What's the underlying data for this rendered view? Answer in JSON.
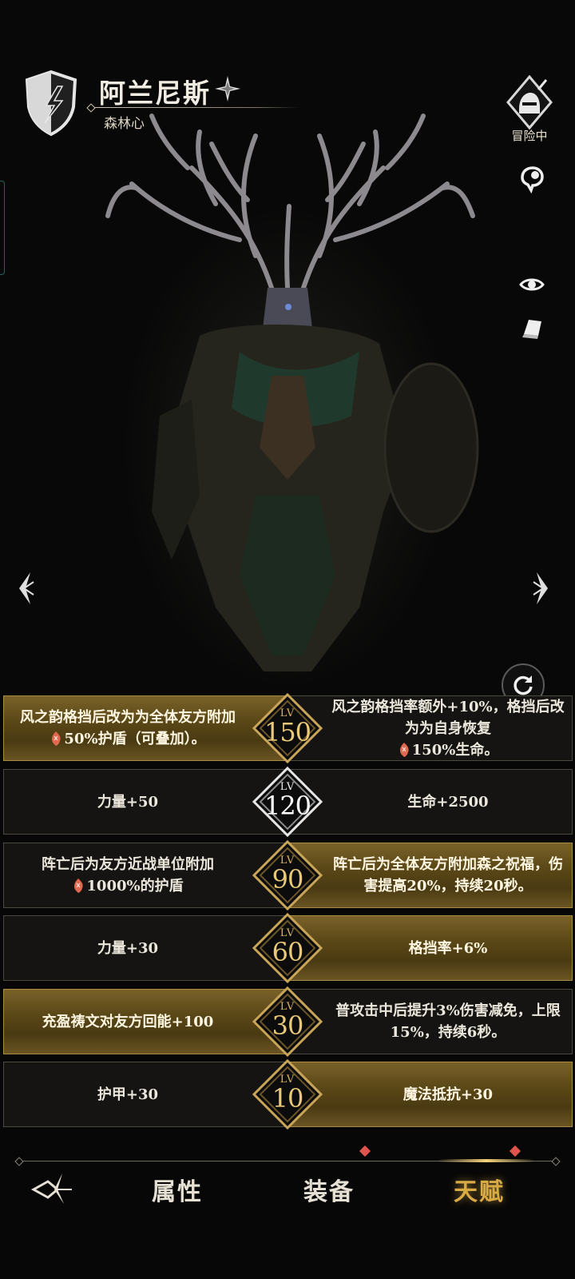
{
  "header": {
    "hero_name": "阿兰尼斯",
    "hero_subtitle": "森林心",
    "status": "冒险中"
  },
  "icons": {
    "class_badge": "lightning-shield-icon",
    "rarity": "star-icon",
    "status": "knight-helmet-sword-icon",
    "side_buttons": [
      "chat-bubble-icon",
      "eye-icon",
      "book-icon"
    ],
    "refresh": "refresh-icon",
    "prev": "arrow-left-icon",
    "next": "arrow-right-icon",
    "rune": "rune-icon"
  },
  "talents": [
    {
      "level_label": "LV",
      "level": "150",
      "left": {
        "text": "风之韵格挡后改为为全体友方附加",
        "rune": true,
        "text2": "50%护盾（可叠加）。",
        "selected": true
      },
      "right": {
        "text": "风之韵格挡率额外+10%，格挡后改为为自身恢复",
        "rune": true,
        "text2": "150%生命。",
        "selected": false
      }
    },
    {
      "level_label": "LV",
      "level": "120",
      "left": {
        "text": "力量+50",
        "selected": false
      },
      "right": {
        "text": "生命+2500",
        "selected": false
      }
    },
    {
      "level_label": "LV",
      "level": "90",
      "left": {
        "text": "阵亡后为友方近战单位附加",
        "rune": true,
        "text2": "1000%的护盾",
        "selected": false
      },
      "right": {
        "text": "阵亡后为全体友方附加森之祝福，伤害提高20%，持续20秒。",
        "selected": true
      }
    },
    {
      "level_label": "LV",
      "level": "60",
      "left": {
        "text": "力量+30",
        "selected": false
      },
      "right": {
        "text": "格挡率+6%",
        "selected": true
      }
    },
    {
      "level_label": "LV",
      "level": "30",
      "left": {
        "text": "充盈祷文对友方回能+100",
        "selected": true
      },
      "right": {
        "text": "普攻击中后提升3%伤害减免，上限15%，持续6秒。",
        "selected": false
      }
    },
    {
      "level_label": "LV",
      "level": "10",
      "left": {
        "text": "护甲+30",
        "selected": false
      },
      "right": {
        "text": "魔法抵抗+30",
        "selected": true
      }
    }
  ],
  "tabs": [
    {
      "label": "属性",
      "active": false,
      "notification": false
    },
    {
      "label": "装备",
      "active": false,
      "notification": true
    },
    {
      "label": "天赋",
      "active": true,
      "notification": true
    }
  ],
  "colors": {
    "gold": "#d9ab45",
    "gold_panel": "#5a4717",
    "dark_panel": "#151412",
    "notify": "#e0544e"
  }
}
